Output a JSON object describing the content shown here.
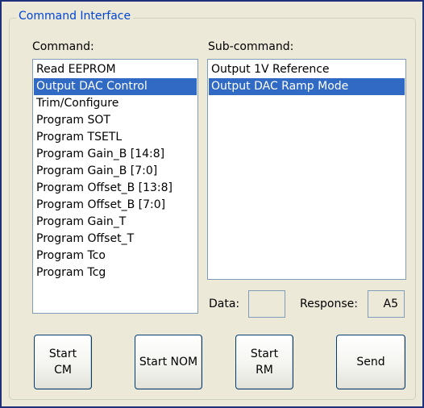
{
  "group": {
    "title": "Command Interface"
  },
  "command": {
    "label": "Command:",
    "selected_index": 1,
    "items": [
      "Read EEPROM",
      "Output DAC Control",
      "Trim/Configure",
      "Program SOT",
      "Program TSETL",
      "Program Gain_B [14:8]",
      "Program Gain_B [7:0]",
      "Program Offset_B [13:8]",
      "Program Offset_B [7:0]",
      "Program Gain_T",
      "Program Offset_T",
      "Program Tco",
      "Program Tcg"
    ]
  },
  "subcommand": {
    "label": "Sub-command:",
    "selected_index": 1,
    "items": [
      "Output 1V Reference",
      "Output DAC Ramp Mode"
    ]
  },
  "data_field": {
    "label": "Data:",
    "value": ""
  },
  "response_field": {
    "label": "Response:",
    "value": "A5"
  },
  "buttons": {
    "start_cm": {
      "line1": "Start",
      "line2": "CM"
    },
    "start_nom": {
      "line1": "Start NOM"
    },
    "start_rm": {
      "line1": "Start",
      "line2": "RM"
    },
    "send": {
      "line1": "Send"
    }
  },
  "colors": {
    "accent": "#0046d5",
    "selection": "#316ac5",
    "window_border": "#1f2f7a",
    "background": "#ece9d8"
  }
}
